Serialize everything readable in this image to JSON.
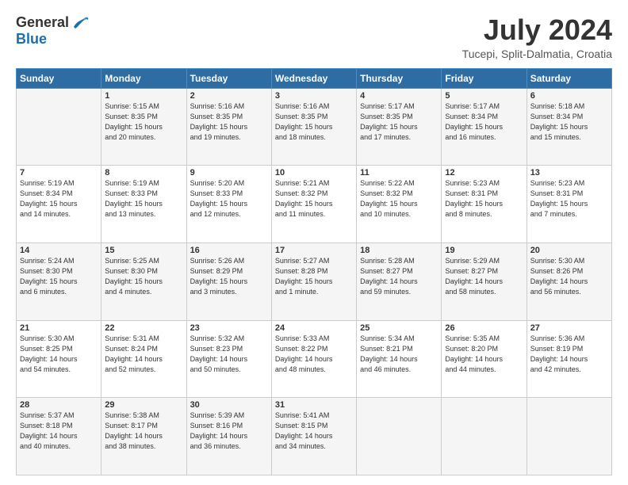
{
  "logo": {
    "general": "General",
    "blue": "Blue"
  },
  "title": "July 2024",
  "subtitle": "Tucepi, Split-Dalmatia, Croatia",
  "days_of_week": [
    "Sunday",
    "Monday",
    "Tuesday",
    "Wednesday",
    "Thursday",
    "Friday",
    "Saturday"
  ],
  "weeks": [
    [
      {
        "day": "",
        "info": ""
      },
      {
        "day": "1",
        "info": "Sunrise: 5:15 AM\nSunset: 8:35 PM\nDaylight: 15 hours\nand 20 minutes."
      },
      {
        "day": "2",
        "info": "Sunrise: 5:16 AM\nSunset: 8:35 PM\nDaylight: 15 hours\nand 19 minutes."
      },
      {
        "day": "3",
        "info": "Sunrise: 5:16 AM\nSunset: 8:35 PM\nDaylight: 15 hours\nand 18 minutes."
      },
      {
        "day": "4",
        "info": "Sunrise: 5:17 AM\nSunset: 8:35 PM\nDaylight: 15 hours\nand 17 minutes."
      },
      {
        "day": "5",
        "info": "Sunrise: 5:17 AM\nSunset: 8:34 PM\nDaylight: 15 hours\nand 16 minutes."
      },
      {
        "day": "6",
        "info": "Sunrise: 5:18 AM\nSunset: 8:34 PM\nDaylight: 15 hours\nand 15 minutes."
      }
    ],
    [
      {
        "day": "7",
        "info": "Sunrise: 5:19 AM\nSunset: 8:34 PM\nDaylight: 15 hours\nand 14 minutes."
      },
      {
        "day": "8",
        "info": "Sunrise: 5:19 AM\nSunset: 8:33 PM\nDaylight: 15 hours\nand 13 minutes."
      },
      {
        "day": "9",
        "info": "Sunrise: 5:20 AM\nSunset: 8:33 PM\nDaylight: 15 hours\nand 12 minutes."
      },
      {
        "day": "10",
        "info": "Sunrise: 5:21 AM\nSunset: 8:32 PM\nDaylight: 15 hours\nand 11 minutes."
      },
      {
        "day": "11",
        "info": "Sunrise: 5:22 AM\nSunset: 8:32 PM\nDaylight: 15 hours\nand 10 minutes."
      },
      {
        "day": "12",
        "info": "Sunrise: 5:23 AM\nSunset: 8:31 PM\nDaylight: 15 hours\nand 8 minutes."
      },
      {
        "day": "13",
        "info": "Sunrise: 5:23 AM\nSunset: 8:31 PM\nDaylight: 15 hours\nand 7 minutes."
      }
    ],
    [
      {
        "day": "14",
        "info": "Sunrise: 5:24 AM\nSunset: 8:30 PM\nDaylight: 15 hours\nand 6 minutes."
      },
      {
        "day": "15",
        "info": "Sunrise: 5:25 AM\nSunset: 8:30 PM\nDaylight: 15 hours\nand 4 minutes."
      },
      {
        "day": "16",
        "info": "Sunrise: 5:26 AM\nSunset: 8:29 PM\nDaylight: 15 hours\nand 3 minutes."
      },
      {
        "day": "17",
        "info": "Sunrise: 5:27 AM\nSunset: 8:28 PM\nDaylight: 15 hours\nand 1 minute."
      },
      {
        "day": "18",
        "info": "Sunrise: 5:28 AM\nSunset: 8:27 PM\nDaylight: 14 hours\nand 59 minutes."
      },
      {
        "day": "19",
        "info": "Sunrise: 5:29 AM\nSunset: 8:27 PM\nDaylight: 14 hours\nand 58 minutes."
      },
      {
        "day": "20",
        "info": "Sunrise: 5:30 AM\nSunset: 8:26 PM\nDaylight: 14 hours\nand 56 minutes."
      }
    ],
    [
      {
        "day": "21",
        "info": "Sunrise: 5:30 AM\nSunset: 8:25 PM\nDaylight: 14 hours\nand 54 minutes."
      },
      {
        "day": "22",
        "info": "Sunrise: 5:31 AM\nSunset: 8:24 PM\nDaylight: 14 hours\nand 52 minutes."
      },
      {
        "day": "23",
        "info": "Sunrise: 5:32 AM\nSunset: 8:23 PM\nDaylight: 14 hours\nand 50 minutes."
      },
      {
        "day": "24",
        "info": "Sunrise: 5:33 AM\nSunset: 8:22 PM\nDaylight: 14 hours\nand 48 minutes."
      },
      {
        "day": "25",
        "info": "Sunrise: 5:34 AM\nSunset: 8:21 PM\nDaylight: 14 hours\nand 46 minutes."
      },
      {
        "day": "26",
        "info": "Sunrise: 5:35 AM\nSunset: 8:20 PM\nDaylight: 14 hours\nand 44 minutes."
      },
      {
        "day": "27",
        "info": "Sunrise: 5:36 AM\nSunset: 8:19 PM\nDaylight: 14 hours\nand 42 minutes."
      }
    ],
    [
      {
        "day": "28",
        "info": "Sunrise: 5:37 AM\nSunset: 8:18 PM\nDaylight: 14 hours\nand 40 minutes."
      },
      {
        "day": "29",
        "info": "Sunrise: 5:38 AM\nSunset: 8:17 PM\nDaylight: 14 hours\nand 38 minutes."
      },
      {
        "day": "30",
        "info": "Sunrise: 5:39 AM\nSunset: 8:16 PM\nDaylight: 14 hours\nand 36 minutes."
      },
      {
        "day": "31",
        "info": "Sunrise: 5:41 AM\nSunset: 8:15 PM\nDaylight: 14 hours\nand 34 minutes."
      },
      {
        "day": "",
        "info": ""
      },
      {
        "day": "",
        "info": ""
      },
      {
        "day": "",
        "info": ""
      }
    ]
  ]
}
